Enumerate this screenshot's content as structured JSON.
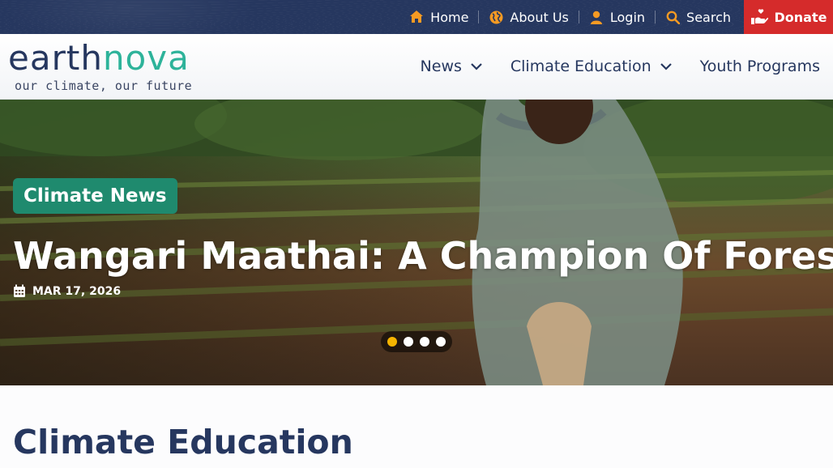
{
  "topbar": {
    "links": [
      {
        "label": "Home",
        "icon": "home-icon"
      },
      {
        "label": "About Us",
        "icon": "globe-icon"
      },
      {
        "label": "Login",
        "icon": "user-icon"
      },
      {
        "label": "Search",
        "icon": "search-icon"
      }
    ],
    "donate_label": "Donate",
    "donate_icon": "heart-hand-icon",
    "icon_color": "#f59a23",
    "bg_color": "#26375f",
    "donate_color": "#d52b2b"
  },
  "logo": {
    "word_part1": "earth",
    "word_part2": "nova",
    "tagline": "our climate, our future",
    "color_primary": "#26375f",
    "color_accent": "#2db39a"
  },
  "nav": {
    "items": [
      {
        "label": "News",
        "has_dropdown": true
      },
      {
        "label": "Climate Education",
        "has_dropdown": true
      },
      {
        "label": "Youth Programs",
        "has_dropdown": false
      }
    ]
  },
  "hero": {
    "category": "Climate News",
    "title": "Wangari Maathai: A Champion Of Forests",
    "date": "MAR 17, 2026",
    "slides_total": 4,
    "active_slide": 1,
    "badge_color": "#1f8a6e",
    "active_dot_color": "#f5b400"
  },
  "section": {
    "title": "Climate Education"
  }
}
